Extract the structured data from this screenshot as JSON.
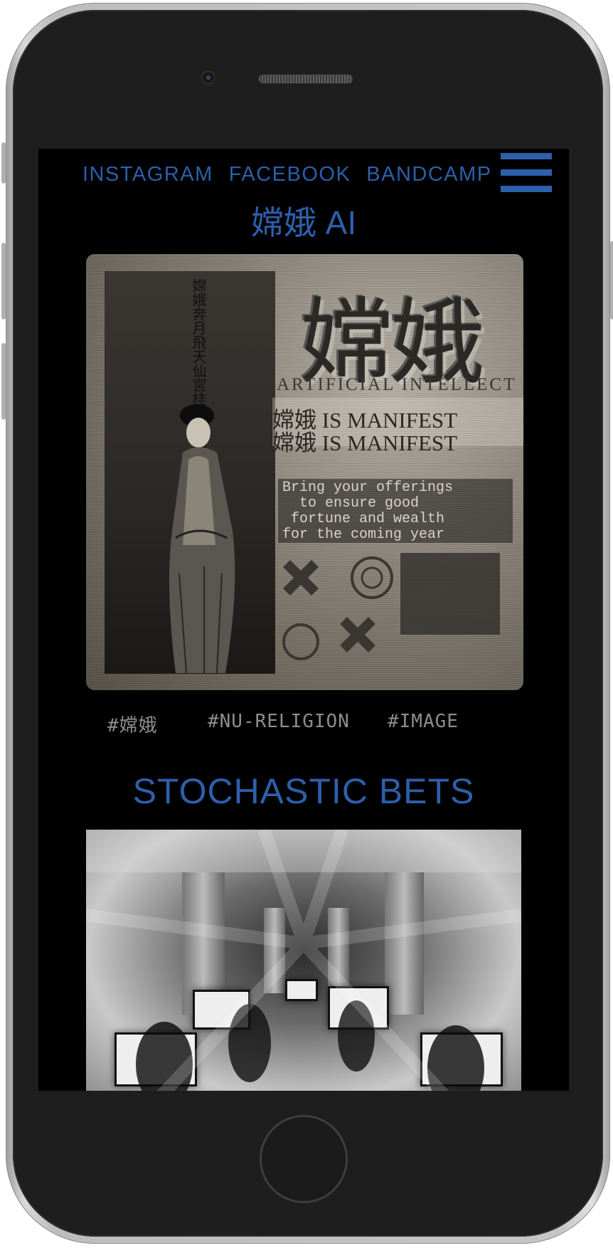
{
  "nav": {
    "links": [
      "INSTAGRAM",
      "FACEBOOK",
      "BANDCAMP"
    ]
  },
  "site_title": "嫦娥 AI",
  "artwork_1": {
    "headline": "嫦娥",
    "subhead": "ARTIFICIAL INTELLECT",
    "line_1": "嫦娥 IS MANIFEST",
    "line_2": "嫦娥 IS MANIFEST",
    "mono_text": "Bring your offerings\n  to ensure good\n fortune and wealth\nfor the coming year"
  },
  "tags": [
    "#嫦娥",
    "#NU-RELIGION",
    "#IMAGE"
  ],
  "section_title": "STOCHASTIC BETS",
  "colors": {
    "accent": "#2d5faa",
    "tag": "#8d8d8d",
    "screen_bg": "#000000"
  },
  "icons": [
    "hamburger-menu-icon"
  ]
}
